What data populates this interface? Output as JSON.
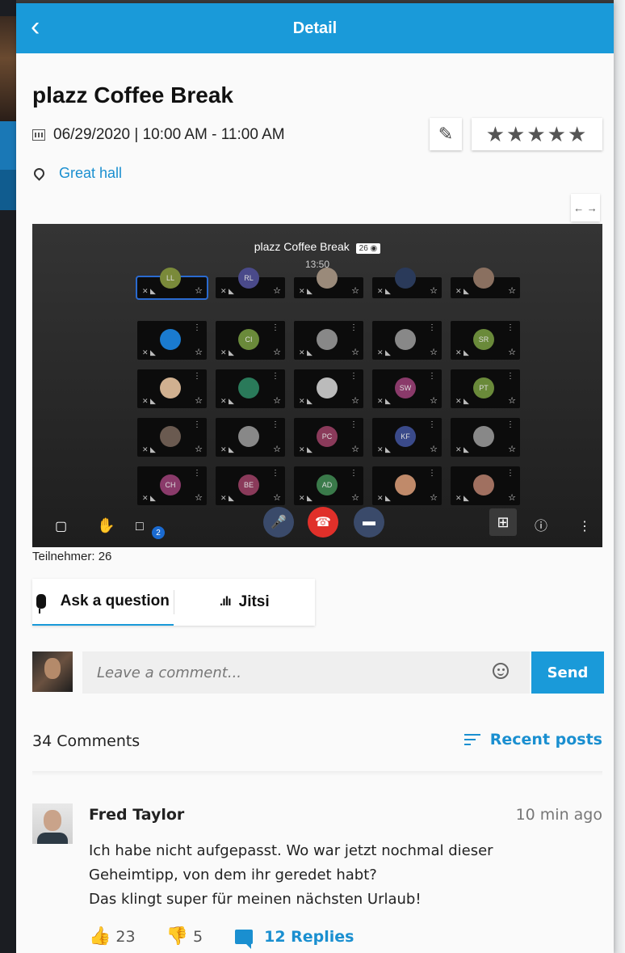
{
  "header": {
    "back_icon": "chevron-left-icon",
    "title": "Detail"
  },
  "event": {
    "title": "plazz Coffee Break",
    "datetime": "06/29/2020 | 10:00 AM - 11:00 AM",
    "location": "Great hall",
    "rating_stars": "★★★★★",
    "rating_value": 5
  },
  "video": {
    "meeting_title": "plazz Coffee Break",
    "participant_badge": "26",
    "timer": "13:50",
    "tiles": [
      {
        "initials": "LL",
        "color": "#7a8a3a"
      },
      {
        "initials": "RL",
        "color": "#4a4a8a"
      },
      {
        "initials": "",
        "color": "#9a8a7a"
      },
      {
        "initials": "",
        "color": "#2a3a5a"
      },
      {
        "initials": "",
        "color": "#8a7060"
      },
      {
        "initials": "",
        "color": "#1a7bd0"
      },
      {
        "initials": "CI",
        "color": "#6a8a3a"
      },
      {
        "initials": "",
        "color": "#888"
      },
      {
        "initials": "",
        "color": "#888"
      },
      {
        "initials": "SR",
        "color": "#6a8a3a"
      },
      {
        "initials": "",
        "color": "#d0b090"
      },
      {
        "initials": "",
        "color": "#2a7a5a"
      },
      {
        "initials": "",
        "color": "#bbb"
      },
      {
        "initials": "SW",
        "color": "#8a3a6a"
      },
      {
        "initials": "PT",
        "color": "#6a8a3a"
      },
      {
        "initials": "",
        "color": "#6a5a50"
      },
      {
        "initials": "",
        "color": "#888"
      },
      {
        "initials": "PC",
        "color": "#8a3a5a"
      },
      {
        "initials": "KF",
        "color": "#3a4a8a"
      },
      {
        "initials": "",
        "color": "#888"
      },
      {
        "initials": "CH",
        "color": "#8a3a6a"
      },
      {
        "initials": "BE",
        "color": "#8a3a5a"
      },
      {
        "initials": "AD",
        "color": "#3a7a4a"
      },
      {
        "initials": "",
        "color": "#c08a6a"
      },
      {
        "initials": "",
        "color": "#a07060"
      }
    ],
    "chat_badge": "2"
  },
  "participants_label": "Teilnehmer: 26",
  "tabs": [
    {
      "label": "Ask a question",
      "icon": "microphone-icon",
      "active": true
    },
    {
      "label": "Jitsi",
      "icon": "bar-chart-icon",
      "active": false
    }
  ],
  "comment_box": {
    "placeholder": "Leave a comment...",
    "send_label": "Send"
  },
  "comments_meta": {
    "count_label": "34 Comments",
    "sort_label": "Recent posts"
  },
  "post": {
    "author": "Fred Taylor",
    "time": "10 min ago",
    "lines": [
      "Ich habe nicht aufgepasst. Wo war jetzt nochmal dieser",
      "Geheimtipp, von dem ihr geredet habt?",
      "Das klingt super für meinen nächsten Urlaub!"
    ],
    "likes": "23",
    "dislikes": "5",
    "replies_label": "12 Replies"
  },
  "colors": {
    "accent": "#1a9ad9",
    "link": "#1a8fd0",
    "hangup": "#e0302a"
  }
}
